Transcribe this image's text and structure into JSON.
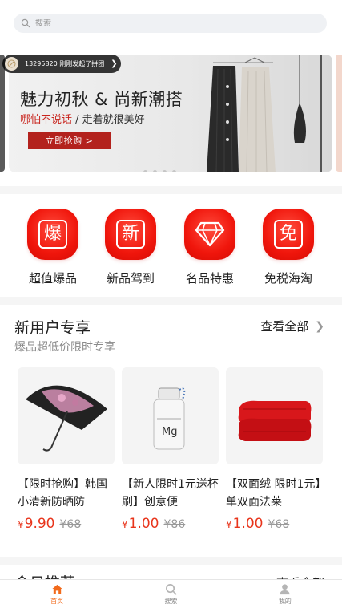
{
  "search": {
    "placeholder": "搜索"
  },
  "toast": {
    "text": "13295820  刚刚发起了拼团"
  },
  "banner": {
    "title": "魅力初秋 & 尚新潮搭",
    "subtitle_red": "哪怕不说话",
    "subtitle_rest": " / 走着就很美好",
    "cta": "立即抢购 >",
    "dot_count": 4
  },
  "categories": [
    {
      "glyph": "爆",
      "label": "超值爆品",
      "icon": "explosive-deal-icon"
    },
    {
      "glyph": "新",
      "label": "新品驾到",
      "icon": "new-arrival-icon"
    },
    {
      "glyph": "◆",
      "label": "名品特惠",
      "icon": "diamond-icon"
    },
    {
      "glyph": "免",
      "label": "免税海淘",
      "icon": "duty-free-icon"
    }
  ],
  "new_user": {
    "title": "新用户专享",
    "subtitle": "爆品超低价限时专享",
    "more": "查看全部",
    "products": [
      {
        "name": "【限时抢购】韩国小清新防晒防",
        "price": "9.90",
        "old_price": "¥68",
        "currency": "¥"
      },
      {
        "name": "【新人限时1元送杯刷】创意便",
        "price": "1.00",
        "old_price": "¥86",
        "currency": "¥"
      },
      {
        "name": "【双面绒 限时1元】单双面法莱",
        "price": "1.00",
        "old_price": "¥68",
        "currency": "¥"
      }
    ]
  },
  "next_section": {
    "title": "今日推荐",
    "more": "查看全部"
  },
  "tabbar": {
    "items": [
      {
        "label": "首页",
        "active": true
      },
      {
        "label": "搜索",
        "active": false
      },
      {
        "label": "我的",
        "active": false
      }
    ]
  },
  "colors": {
    "accent": "#f26a1b",
    "price": "#e8341b",
    "category_red": "#f0160c",
    "banner_cta": "#b3221d"
  }
}
